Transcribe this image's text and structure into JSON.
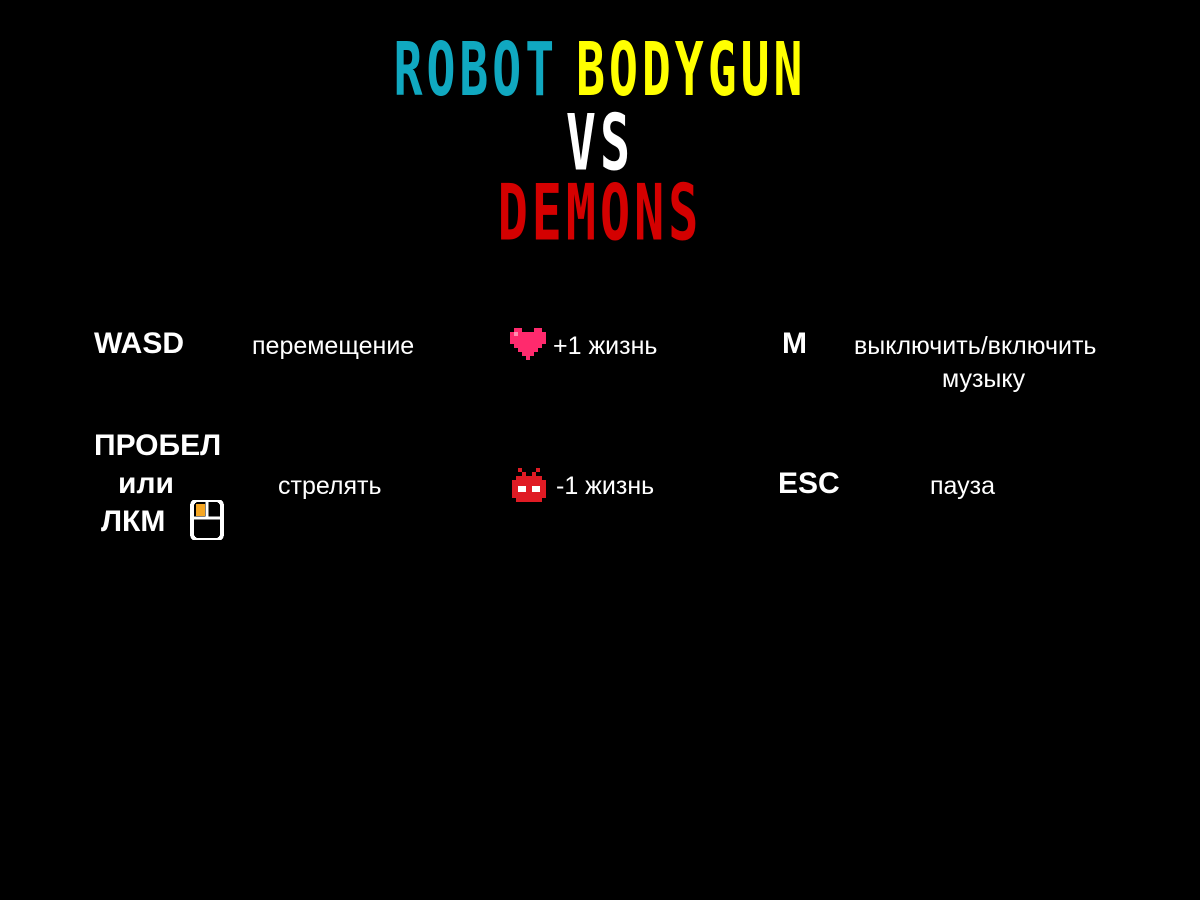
{
  "title": {
    "word1": "ROBOT",
    "word2": "BODYGUN",
    "word3": "VS",
    "word4": "DEMONS",
    "colors": {
      "word1": "#10a8c0",
      "word2": "#ffff00",
      "word3": "#ffffff",
      "word4": "#d40000"
    }
  },
  "controls": {
    "move": {
      "key": "WASD",
      "description": "перемещение"
    },
    "shoot": {
      "key_line1": "ПРОБЕЛ",
      "key_line2": "или",
      "key_line3": "ЛКМ",
      "icon": "mouse-left-click-icon",
      "description": "стрелять"
    },
    "music": {
      "key": "M",
      "description_line1": "выключить/включить",
      "description_line2": "музыку"
    },
    "pause": {
      "key": "ESC",
      "description": "пауза"
    }
  },
  "legend": {
    "heart": {
      "icon": "heart-icon",
      "text": "+1 жизнь",
      "color": "#ff2a6d"
    },
    "demon": {
      "icon": "demon-icon",
      "text": "-1 жизнь",
      "color": "#e01b24"
    }
  },
  "mouse_highlight_color": "#f5a623"
}
